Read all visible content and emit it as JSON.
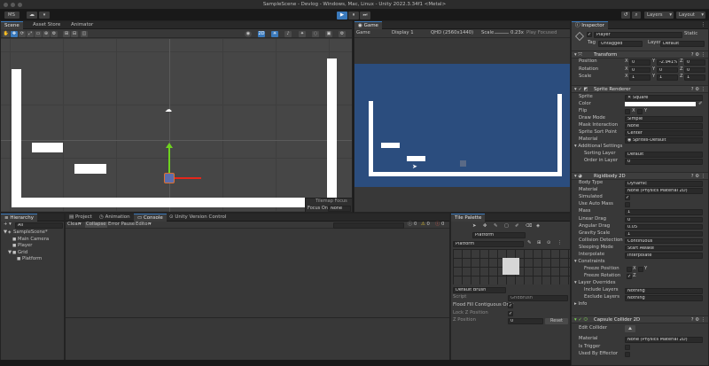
{
  "titlebar": {
    "title": "SampleScene - Devlog - Windows, Mac, Linux - Unity 2022.3.34f1 <Metal>"
  },
  "toolbar": {
    "account": "MS",
    "play": "▶",
    "pause": "⏸",
    "step": "⏭",
    "history": "↺",
    "search": "⌕",
    "layers": "Layers",
    "layout": "Layout"
  },
  "scene": {
    "tabs": {
      "scene": "Scene",
      "asset_store": "Asset Store",
      "animator": "Animator"
    },
    "tools": [
      "✋",
      "✥",
      "⟳",
      "⤢",
      "▭",
      "⊕",
      "⚙"
    ],
    "overlay_title": "Tilemap Focus",
    "overlay_label": "Focus On",
    "overlay_value": "None"
  },
  "game": {
    "tab": "Game",
    "display": "Game",
    "display_num": "Display 1",
    "resolution": "QHD (2560x1440)",
    "scale_label": "Scale",
    "scale_value": "0.23x",
    "play_focused": "Play Focused",
    "bg": "#2b4d7e"
  },
  "hierarchy": {
    "tab": "Hierarchy",
    "add": "+ ▾",
    "search": "All",
    "items": [
      {
        "label": "SampleScene*",
        "indent": 0,
        "arrow": "▼",
        "icon": "◈"
      },
      {
        "label": "Main Camera",
        "indent": 1,
        "arrow": "",
        "icon": "■"
      },
      {
        "label": "Player",
        "indent": 1,
        "arrow": "",
        "icon": "■"
      },
      {
        "label": "Grid",
        "indent": 1,
        "arrow": "▼",
        "icon": "■"
      },
      {
        "label": "Platform",
        "indent": 2,
        "arrow": "",
        "icon": "■"
      }
    ]
  },
  "console": {
    "tabs": {
      "project": "Project",
      "animation": "Animation",
      "console": "Console",
      "version": "Unity Version Control"
    },
    "buttons": {
      "clear": "Clear",
      "collapse": "Collapse",
      "error_pause": "Error Pause",
      "editor": "Editor"
    },
    "counts": {
      "log": "0",
      "warn": "0",
      "error": "0"
    }
  },
  "tile_palette": {
    "tab": "Tile Palette",
    "active_tilemap": "Platform",
    "palette": "Platform",
    "brush": "Default Brush",
    "script_label": "Script",
    "script_value": "GridBrush",
    "rows": [
      {
        "label": "Flood Fill Contiguous Only",
        "checked": true
      },
      {
        "label": "Lock Z Position",
        "checked": true
      },
      {
        "label": "Z Position",
        "value": "0"
      }
    ],
    "reset": "Reset"
  },
  "inspector": {
    "tab": "Inspector",
    "object": {
      "name": "Player",
      "static": "Static",
      "tag_label": "Tag",
      "tag": "Untagged",
      "layer_label": "Layer",
      "layer": "Default"
    },
    "transform": {
      "title": "Transform",
      "rows": [
        {
          "label": "Position",
          "x": "0",
          "y": "-2.941%",
          "z": "0"
        },
        {
          "label": "Rotation",
          "x": "0",
          "y": "0",
          "z": "0"
        },
        {
          "label": "Scale",
          "x": "1",
          "y": "1",
          "z": "1"
        }
      ]
    },
    "sprite_renderer": {
      "title": "Sprite Renderer",
      "sprite_label": "Sprite",
      "sprite": "Square",
      "color_label": "Color",
      "flip_label": "Flip",
      "flip_x": "X",
      "flip_y": "Y",
      "draw_mode_label": "Draw Mode",
      "draw_mode": "Simple",
      "mask_label": "Mask Interaction",
      "mask": "None",
      "sort_point_label": "Sprite Sort Point",
      "sort_point": "Center",
      "material_label": "Material",
      "material": "Sprites-Default",
      "additional": "Additional Settings",
      "sorting_layer_label": "Sorting Layer",
      "sorting_layer": "Default",
      "order_label": "Order in Layer",
      "order": "0"
    },
    "rigidbody": {
      "title": "Rigidbody 2D",
      "rows": [
        {
          "label": "Body Type",
          "value": "Dynamic"
        },
        {
          "label": "Material",
          "value": "None (Physics Material 2D)"
        },
        {
          "label": "Simulated",
          "check": true
        },
        {
          "label": "Use Auto Mass",
          "check": false
        },
        {
          "label": "Mass",
          "value": "1"
        },
        {
          "label": "Linear Drag",
          "value": "0"
        },
        {
          "label": "Angular Drag",
          "value": "0.05"
        },
        {
          "label": "Gravity Scale",
          "value": "1"
        },
        {
          "label": "Collision Detection",
          "value": "Continuous"
        },
        {
          "label": "Sleeping Mode",
          "value": "Start Awake"
        },
        {
          "label": "Interpolate",
          "value": "Interpolate"
        }
      ],
      "constraints": "Constraints",
      "freeze_pos_label": "Freeze Position",
      "freeze_rot_label": "Freeze Rotation",
      "x": "X",
      "y": "Y",
      "z": "Z",
      "layer_overrides": "Layer Overrides",
      "include_label": "Include Layers",
      "include": "Nothing",
      "exclude_label": "Exclude Layers",
      "exclude": "Nothing",
      "info": "Info"
    },
    "capsule": {
      "title": "Capsule Collider 2D",
      "edit_label": "Edit Collider",
      "material_label": "Material",
      "material": "None (Physics Material 2D)",
      "trigger_label": "Is Trigger",
      "effector_label": "Used By Effector"
    }
  },
  "colors": {
    "accent": "#3a79bb",
    "bg": "#383838",
    "tabbar": "#282828",
    "game_bg": "#2b4d7e",
    "player_outline": "#e0702f"
  }
}
